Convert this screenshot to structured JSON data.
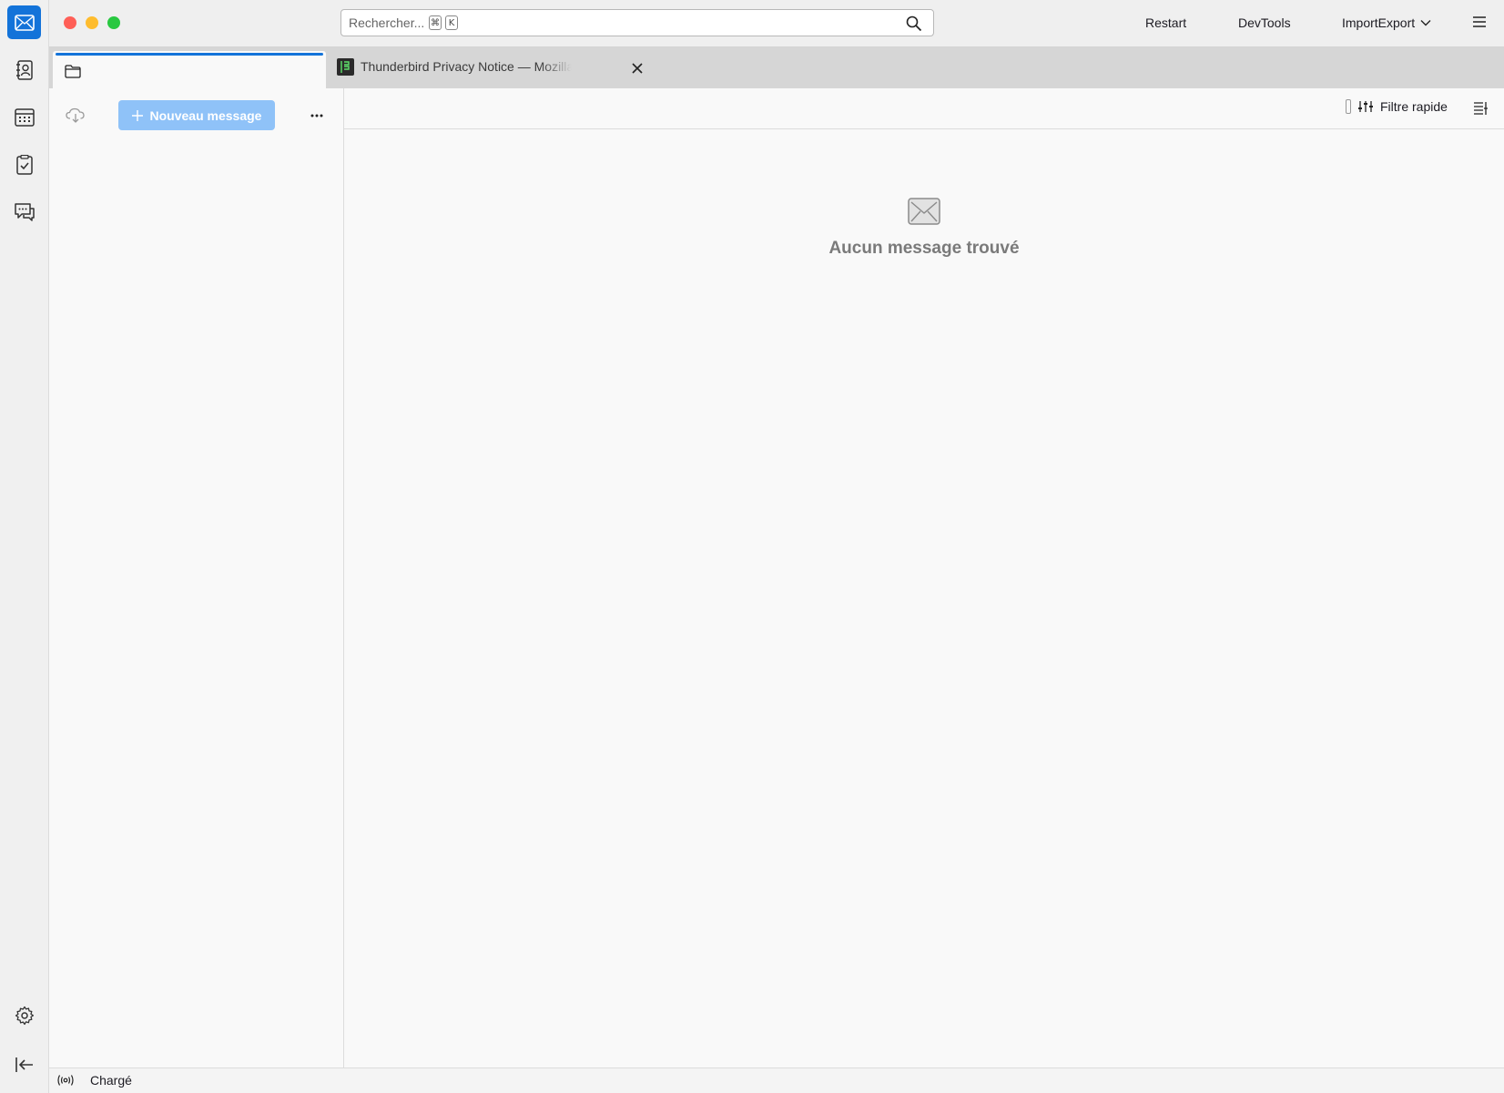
{
  "spaces": {
    "items": [
      {
        "name": "mail",
        "icon": "mail-icon",
        "active": true
      },
      {
        "name": "address-book",
        "icon": "address-book-icon"
      },
      {
        "name": "calendar",
        "icon": "calendar-icon"
      },
      {
        "name": "tasks",
        "icon": "tasks-icon"
      },
      {
        "name": "chat",
        "icon": "chat-icon"
      }
    ],
    "settings_icon": "gear-icon",
    "collapse_icon": "collapse-icon"
  },
  "titlebar": {
    "search": {
      "placeholder": "Rechercher...",
      "shortcut": [
        "⌘",
        "K"
      ]
    },
    "buttons": {
      "restart": "Restart",
      "devtools": "DevTools",
      "importexport": "ImportExport"
    },
    "menu_icon": "hamburger-icon"
  },
  "tabs": [
    {
      "label": "",
      "icon": "folder-icon",
      "active": true
    },
    {
      "label": "Thunderbird Privacy Notice — Mozilla",
      "icon": "favicon-icon",
      "active": false
    }
  ],
  "folder_pane": {
    "new_message_label": "Nouveau message"
  },
  "thread_pane": {
    "quick_filter_label": "Filtre rapide",
    "empty_message": "Aucun message trouvé"
  },
  "statusbar": {
    "status_text": "Chargé"
  },
  "colors": {
    "accent": "#1373d9",
    "new_message_button": "#8fc2f8",
    "traffic_close": "#ff5f57",
    "traffic_minimize": "#febc2e",
    "traffic_maximize": "#28c840"
  }
}
